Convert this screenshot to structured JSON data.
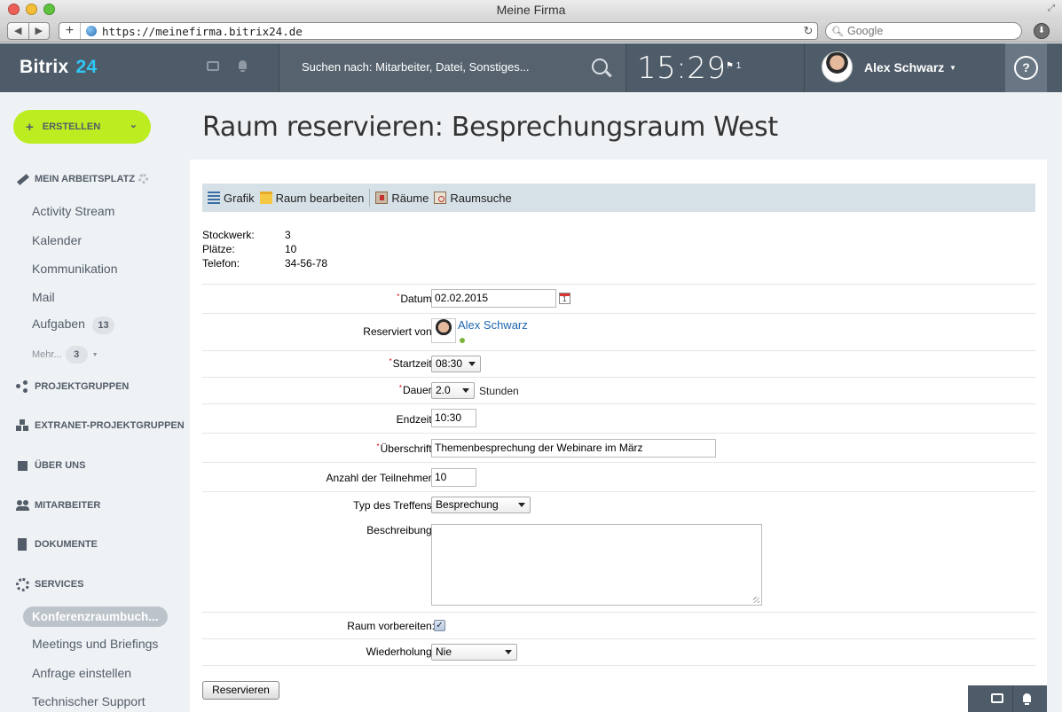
{
  "browser": {
    "window_title": "Meine Firma",
    "url": "https://meinefirma.bitrix24.de",
    "search_placeholder": "Google"
  },
  "header": {
    "logo_text": "Bitrix",
    "logo_num": "24",
    "search_placeholder": "Suchen nach: Mitarbeiter, Datei, Sonstiges...",
    "time": "15:29",
    "flag_count": "1",
    "user_name": "Alex Schwarz",
    "help_label": "?"
  },
  "sidebar": {
    "create_label": "ERSTELLEN",
    "section_workplace": "MEIN ARBEITSPLATZ",
    "items": [
      {
        "label": "Activity Stream"
      },
      {
        "label": "Kalender"
      },
      {
        "label": "Kommunikation"
      },
      {
        "label": "Mail"
      },
      {
        "label": "Aufgaben",
        "badge": "13"
      }
    ],
    "more_label": "Mehr...",
    "more_badge": "3",
    "sections": [
      {
        "label": "PROJEKTGRUPPEN"
      },
      {
        "label": "EXTRANET-PROJEKTGRUPPEN"
      },
      {
        "label": "ÜBER UNS"
      },
      {
        "label": "MITARBEITER"
      },
      {
        "label": "DOKUMENTE"
      },
      {
        "label": "SERVICES"
      }
    ],
    "services_items": [
      {
        "label": "Konferenzraumbuch..."
      },
      {
        "label": "Meetings und Briefings"
      },
      {
        "label": "Anfrage einstellen"
      },
      {
        "label": "Technischer Support"
      }
    ]
  },
  "main": {
    "title": "Raum reservieren: Besprechungsraum West",
    "toolbar": {
      "grafik": "Grafik",
      "raum_bearbeiten": "Raum bearbeiten",
      "raeume": "Räume",
      "raumsuche": "Raumsuche"
    },
    "info": [
      {
        "key": "Stockwerk:",
        "value": "3"
      },
      {
        "key": "Plätze:",
        "value": "10"
      },
      {
        "key": "Telefon:",
        "value": "34-56-78"
      }
    ],
    "form": {
      "datum_label": "Datum:",
      "datum_value": "02.02.2015",
      "reserviert_label": "Reserviert von:",
      "reserviert_value": "Alex Schwarz",
      "startzeit_label": "Startzeit:",
      "startzeit_value": "08:30",
      "dauer_label": "Dauer:",
      "dauer_value": "2.0",
      "dauer_unit": "Stunden",
      "endzeit_label": "Endzeit:",
      "endzeit_value": "10:30",
      "ueberschrift_label": "Überschrift:",
      "ueberschrift_value": "Themenbesprechung der Webinare im März",
      "teilnehmer_label": "Anzahl der Teilnehmer:",
      "teilnehmer_value": "10",
      "typ_label": "Typ des Treffens:",
      "typ_value": "Besprechung",
      "beschreibung_label": "Beschreibung:",
      "beschreibung_value": "",
      "vorbereiten_label": "Raum vorbereiten:",
      "vorbereiten_checked": "✓",
      "wiederholung_label": "Wiederholung:",
      "wiederholung_value": "Nie",
      "submit_label": "Reservieren"
    }
  },
  "colors": {
    "header_bg": "#4e5b68",
    "accent_blue": "#2fc6f6",
    "create_green": "#bbed21",
    "link_blue": "#2067b0"
  }
}
